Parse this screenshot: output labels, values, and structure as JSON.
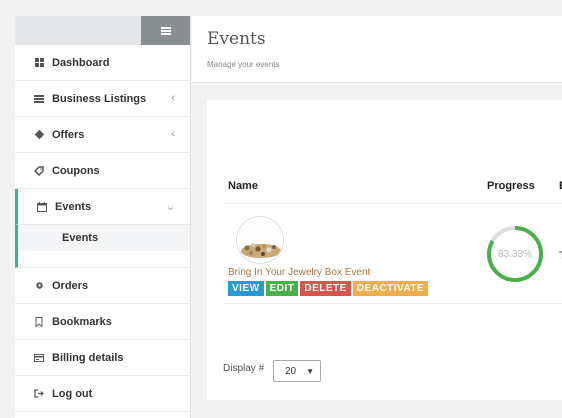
{
  "sidebar": {
    "items": [
      {
        "label": "Dashboard",
        "icon": "grid-icon"
      },
      {
        "label": "Business Listings",
        "icon": "list-icon"
      },
      {
        "label": "Offers",
        "icon": "gear-badge-icon"
      },
      {
        "label": "Coupons",
        "icon": "tag-icon"
      },
      {
        "label": "Events",
        "icon": "calendar-icon"
      },
      {
        "label": "Orders",
        "icon": "cog-icon"
      },
      {
        "label": "Bookmarks",
        "icon": "bookmark-icon"
      },
      {
        "label": "Billing details",
        "icon": "billing-icon"
      },
      {
        "label": "Log out",
        "icon": "logout-icon"
      }
    ],
    "sub_items": [
      {
        "label": "Events"
      }
    ]
  },
  "header": {
    "title": "Events",
    "subtitle": "Manage your events"
  },
  "table": {
    "columns": [
      "Name",
      "Progress",
      "E"
    ],
    "rows": [
      {
        "name": "Bring In Your Jewelry Box Event",
        "progress": "83.33%",
        "progress_value": 0.8333,
        "extra": "T"
      }
    ],
    "actions": [
      "VIEW",
      "EDIT",
      "DELETE",
      "DEACTIVATE"
    ]
  },
  "pagination": {
    "display_label": "Display #",
    "display_value": "20"
  },
  "colors": {
    "accent": "#35b58f",
    "view": "#2a9bd1",
    "edit": "#4ab04a",
    "delete": "#d9534f",
    "deactivate": "#f0ad4e",
    "progress": "#4ab04a",
    "link": "#b0733e"
  }
}
